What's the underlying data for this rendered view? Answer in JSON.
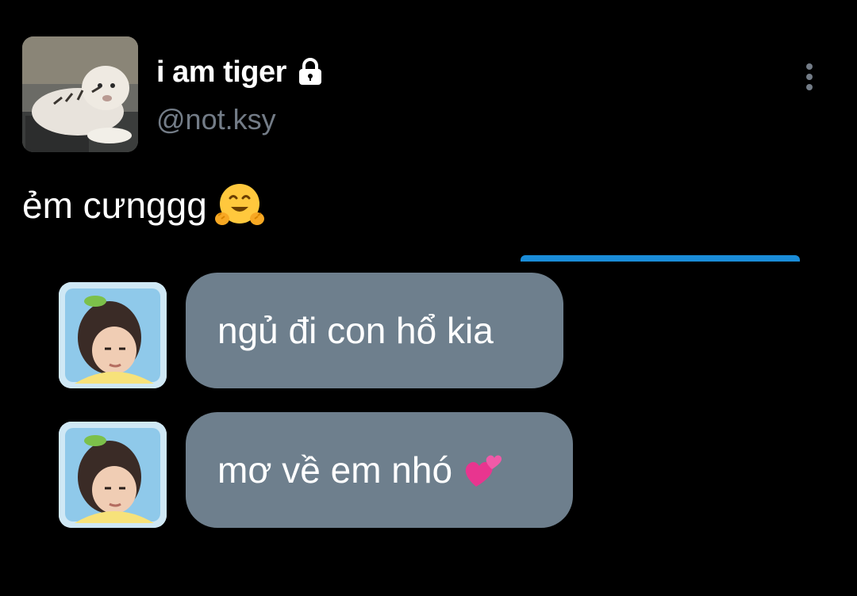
{
  "profile": {
    "display_name": "i am tiger",
    "handle": "@not.ksy",
    "avatar_icon": "white-tiger-photo",
    "protected_icon": "lock-icon"
  },
  "post": {
    "text": "ẻm cưnggg",
    "emoji": "hugging-face-emoji"
  },
  "chat": {
    "messages": [
      {
        "text": "ngủ đi con hổ kia",
        "emoji": ""
      },
      {
        "text": "mơ về em nhó",
        "emoji": "two-hearts-emoji"
      }
    ]
  },
  "colors": {
    "background": "#000000",
    "handle": "#737c87",
    "bubble": "#6e7f8d",
    "accent_bar": "#1a8cd8"
  }
}
